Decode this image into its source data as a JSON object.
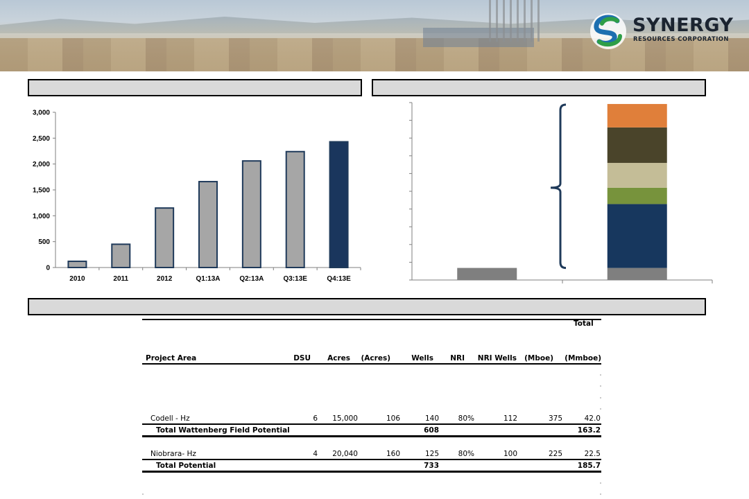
{
  "brand": {
    "name": "SYNERGY",
    "subtitle": "RESOURCES CORPORATION",
    "colors": {
      "green": "#2e9e47",
      "blue": "#1d6fb0",
      "dark": "#1b2430"
    }
  },
  "sections": {
    "left_title": "",
    "right_title": "",
    "bottom_title": ""
  },
  "chart_data": [
    {
      "type": "bar",
      "categories": [
        "2010",
        "2011",
        "2012",
        "Q1:13A",
        "Q2:13A",
        "Q3:13E",
        "Q4:13E"
      ],
      "values": [
        120,
        450,
        1150,
        1660,
        2060,
        2240,
        2430
      ],
      "highlight_index": 6,
      "ylim": [
        0,
        3000
      ],
      "yticks": [
        "0",
        "500",
        "1,000",
        "1,500",
        "2,000",
        "2,500",
        "3,000"
      ],
      "colors": {
        "bar": "#a6a6a6",
        "highlight": "#1a365d",
        "outline": "#1f3a5a"
      }
    },
    {
      "type": "bar",
      "stacked": true,
      "categories": [
        "",
        ""
      ],
      "left_bar_value": 17,
      "segments": [
        {
          "value": 17,
          "color": "#7f7f7f"
        },
        {
          "value": 90,
          "color": "#17375e"
        },
        {
          "value": 23,
          "color": "#77933c"
        },
        {
          "value": 35,
          "color": "#c4bd97"
        },
        {
          "value": 50,
          "color": "#4a442a"
        },
        {
          "value": 33,
          "color": "#e07f3a"
        }
      ],
      "ylim": [
        0,
        250
      ]
    }
  ],
  "table": {
    "super_header": "Total",
    "headers": [
      "Project Area",
      "DSU",
      "Acres",
      "(Acres)",
      "Wells",
      "NRI",
      "NRI Wells",
      "(Mboe)",
      "(Mmboe)"
    ],
    "rows": [
      {
        "name": "Codell - Hz",
        "dsu": "6",
        "acres": "15,000",
        "spacing": "106",
        "wells": "140",
        "nri": "80%",
        "nri_wells": "112",
        "mboe": "375",
        "mmboe": "42.0"
      }
    ],
    "total_wattenberg": {
      "label": "Total Wattenberg Field Potential",
      "wells": "608",
      "mmboe": "163.2"
    },
    "row2": {
      "name": "Niobrara- Hz",
      "dsu": "4",
      "acres": "20,040",
      "spacing": "160",
      "wells": "125",
      "nri": "80%",
      "nri_wells": "100",
      "mboe": "225",
      "mmboe": "22.5"
    },
    "total": {
      "label": "Total Potential",
      "wells": "733",
      "mmboe": "185.7"
    }
  }
}
